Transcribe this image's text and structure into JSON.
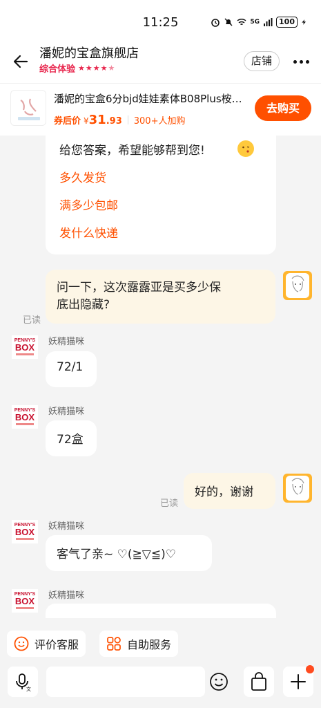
{
  "status": {
    "time": "11:25",
    "network": "5G",
    "battery": "100"
  },
  "header": {
    "shop_name": "潘妮的宝盒旗舰店",
    "rating_label": "综合体验",
    "store_button": "店铺"
  },
  "product": {
    "title": "潘妮的宝盒6分bjd娃娃素体B08Plus桉…",
    "price_label": "券后价",
    "currency": "¥",
    "price_int": "31",
    "price_dec": ".93",
    "buyers": "300+人加购",
    "buy_button": "去购买"
  },
  "chat": {
    "faq": {
      "lead": "给您答案，希望能够帮到您!",
      "questions": [
        "多久发货",
        "满多少包邮",
        "发什么快递"
      ]
    },
    "messages": [
      {
        "from": "me",
        "lines": [
          "问一下，这次露露亚是买多少保",
          "底出隐藏?"
        ],
        "status": "已读"
      },
      {
        "from": "shop",
        "agent": "妖精猫咪",
        "text": "72/1"
      },
      {
        "from": "shop",
        "agent": "妖精猫咪",
        "text": "72盒"
      },
      {
        "from": "me",
        "text": "好的，谢谢",
        "status": "已读"
      },
      {
        "from": "shop",
        "agent": "妖精猫咪",
        "text": "客气了亲~ ♡(≧▽≦)♡"
      },
      {
        "from": "shop",
        "agent": "妖精猫咪",
        "text": ""
      }
    ]
  },
  "quick_actions": {
    "rate_service": "评价客服",
    "self_service": "自助服务"
  },
  "colors": {
    "accent": "#ff5000",
    "rating": "#e8264d",
    "self_bubble": "#fdf6e6"
  }
}
